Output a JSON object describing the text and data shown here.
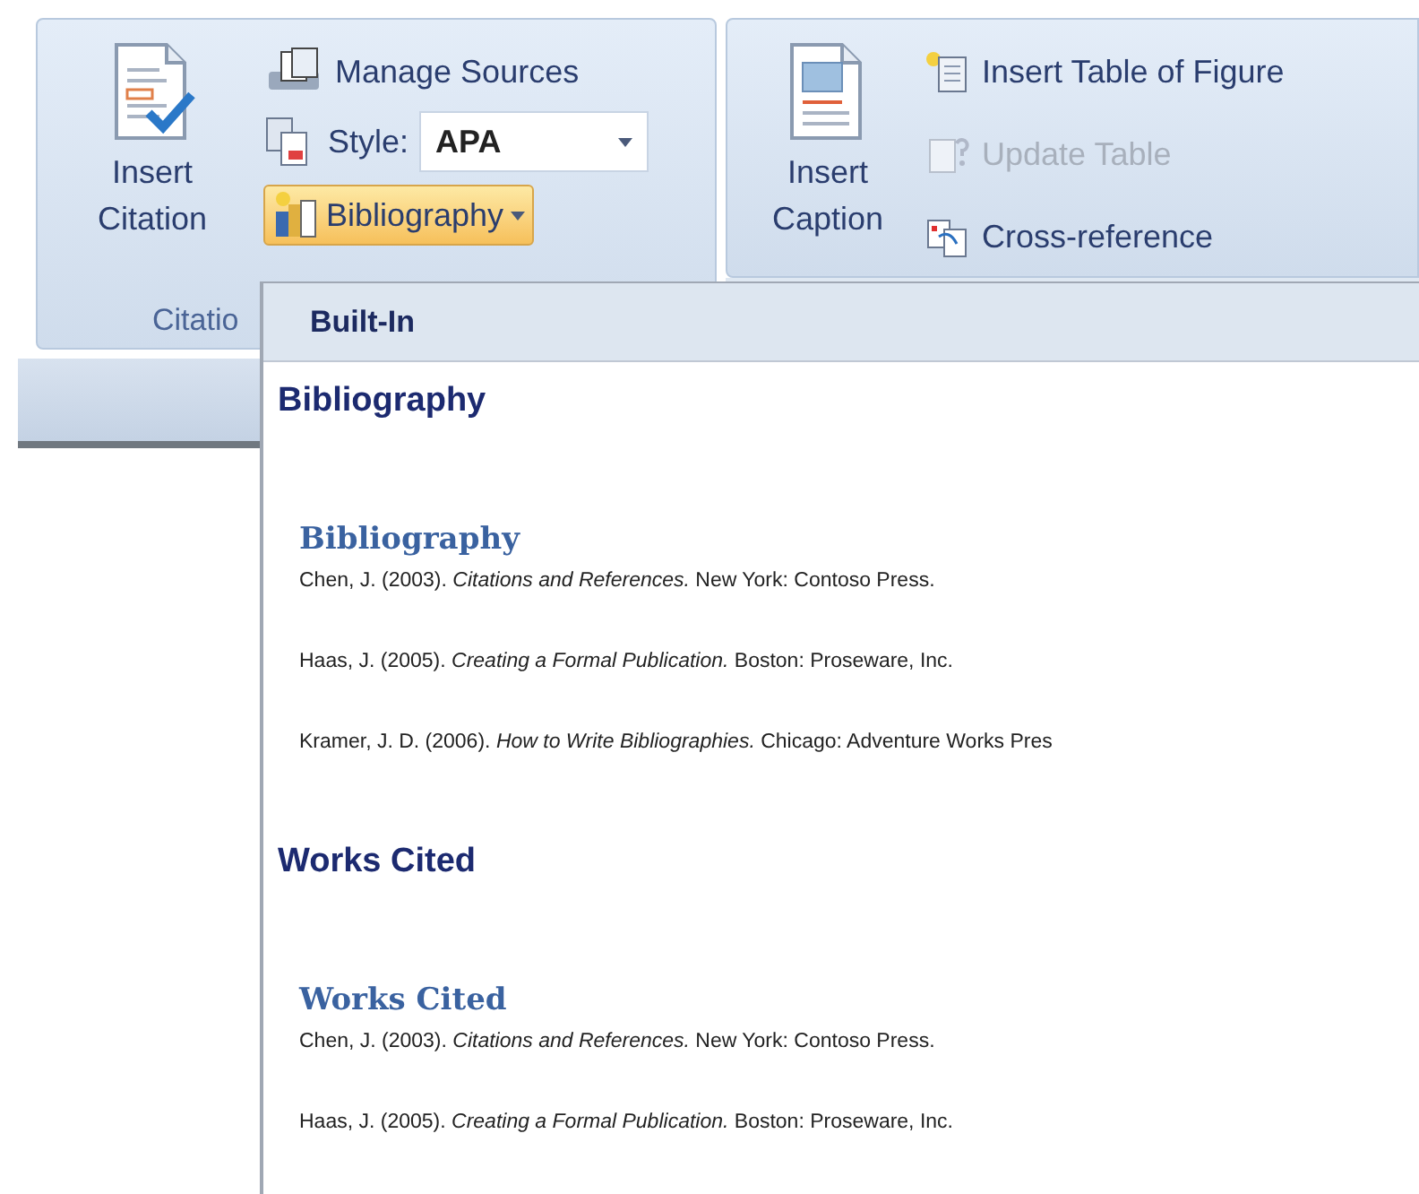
{
  "ribbon": {
    "citations_group": {
      "insert_citation": {
        "label": "Insert\nCitation"
      },
      "manage_sources": {
        "label": "Manage Sources"
      },
      "style": {
        "label": "Style:",
        "value": "APA"
      },
      "bibliography_button": {
        "label": "Bibliography",
        "selected": true
      },
      "group_label": "Citatio"
    },
    "captions_group": {
      "insert_caption": {
        "label": "Insert\nCaption"
      },
      "commands": [
        {
          "kind": "table",
          "label": "Insert Table of Figure",
          "disabled": false
        },
        {
          "kind": "update",
          "label": "Update Table",
          "disabled": true
        },
        {
          "kind": "crossref",
          "label": "Cross-reference",
          "disabled": false
        }
      ]
    }
  },
  "dropdown": {
    "header": "Built-In",
    "items": [
      {
        "name": "Bibliography",
        "preview_title": "Bibliography",
        "entries": [
          "Chen, J. (2003). *Citations and References.* New York: Contoso Press.",
          "Haas, J. (2005). *Creating a Formal Publication.* Boston: Proseware, Inc.",
          "Kramer, J. D. (2006). *How to Write Bibliographies.* Chicago: Adventure Works Pres"
        ]
      },
      {
        "name": "Works Cited",
        "preview_title": "Works Cited",
        "entries": [
          "Chen, J. (2003). *Citations and References.* New York: Contoso Press.",
          "Haas, J. (2005). *Creating a Formal Publication.* Boston: Proseware, Inc."
        ]
      }
    ]
  }
}
